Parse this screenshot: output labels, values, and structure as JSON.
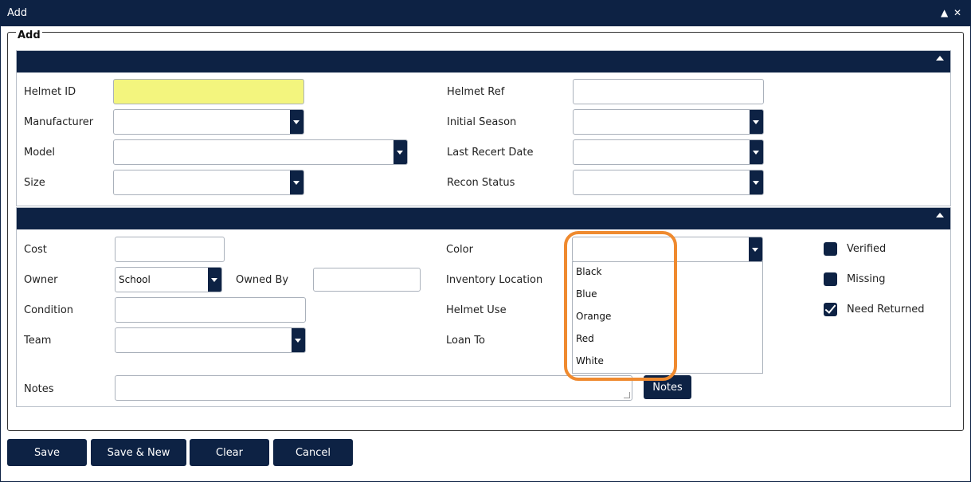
{
  "window": {
    "title": "Add"
  },
  "form": {
    "legend": "Add",
    "fields": {
      "helmet_id": "Helmet ID",
      "helmet_ref": "Helmet Ref",
      "manufacturer": "Manufacturer",
      "initial_season": "Initial Season",
      "model": "Model",
      "last_recert_date": "Last Recert Date",
      "size": "Size",
      "recon_status": "Recon Status",
      "cost": "Cost",
      "color": "Color",
      "owner": "Owner",
      "owner_value": "School",
      "owned_by": "Owned By",
      "inventory_location": "Inventory Location",
      "condition": "Condition",
      "helmet_use": "Helmet Use",
      "team": "Team",
      "loan_to": "Loan To",
      "notes": "Notes"
    },
    "color_dropdown": {
      "options": [
        "Black",
        "Blue",
        "Orange",
        "Red",
        "White"
      ]
    },
    "checkboxes": [
      {
        "label": "Verified",
        "checked": false
      },
      {
        "label": "Missing",
        "checked": false
      },
      {
        "label": "Need Returned",
        "checked": true
      }
    ],
    "notes_button": "Notes"
  },
  "footer": {
    "save": "Save",
    "save_new": "Save & New",
    "clear": "Clear",
    "cancel": "Cancel"
  },
  "colors": {
    "navy": "#0d2244",
    "highlight": "#ef8a2f",
    "required": "#f3f57e"
  }
}
